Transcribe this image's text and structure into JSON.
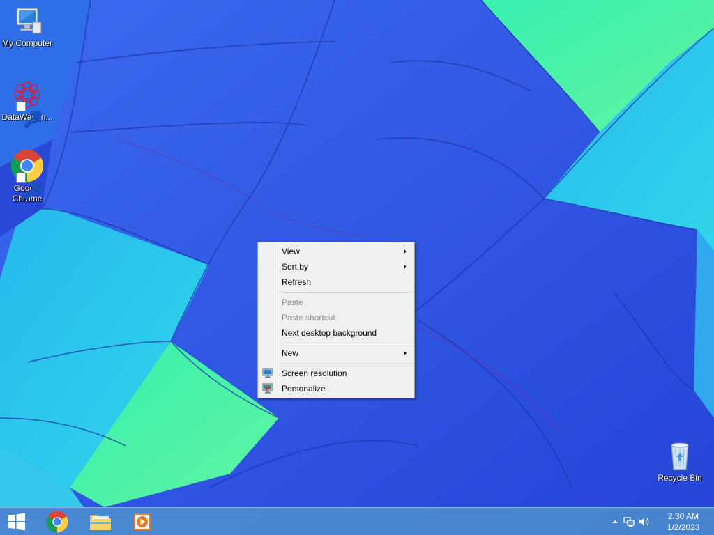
{
  "desktop": {
    "icons": [
      {
        "id": "my-computer",
        "label": "My Computer"
      },
      {
        "id": "datawagon",
        "label": "DataWagon..."
      },
      {
        "id": "google-chrome",
        "label": "Google Chrome"
      },
      {
        "id": "recycle-bin",
        "label": "Recycle Bin"
      }
    ]
  },
  "context_menu": {
    "items": [
      {
        "label": "View",
        "submenu": true,
        "enabled": true
      },
      {
        "label": "Sort by",
        "submenu": true,
        "enabled": true
      },
      {
        "label": "Refresh",
        "enabled": true
      },
      {
        "label": "Paste",
        "enabled": false
      },
      {
        "label": "Paste shortcut",
        "enabled": false
      },
      {
        "label": "Next desktop background",
        "enabled": true
      },
      {
        "label": "New",
        "submenu": true,
        "enabled": true
      },
      {
        "label": "Screen resolution",
        "enabled": true,
        "icon": "display-icon"
      },
      {
        "label": "Personalize",
        "enabled": true,
        "icon": "personalize-icon"
      }
    ]
  },
  "taskbar": {
    "start_icon": "windows-logo-icon",
    "pinned": [
      {
        "name": "Google Chrome",
        "icon": "chrome-icon"
      },
      {
        "name": "File Explorer",
        "icon": "folder-icon"
      },
      {
        "name": "Media Player",
        "icon": "media-player-icon"
      }
    ],
    "tray": {
      "time": "2:30 AM",
      "date": "1/2/2023"
    }
  },
  "colors": {
    "wallpaper_blue": "#2f52e0",
    "wallpaper_cyan": "#2ad0e8",
    "wallpaper_green": "#4af0a8",
    "menu_bg": "#f0f0f0",
    "taskbar": "#5096cd"
  }
}
